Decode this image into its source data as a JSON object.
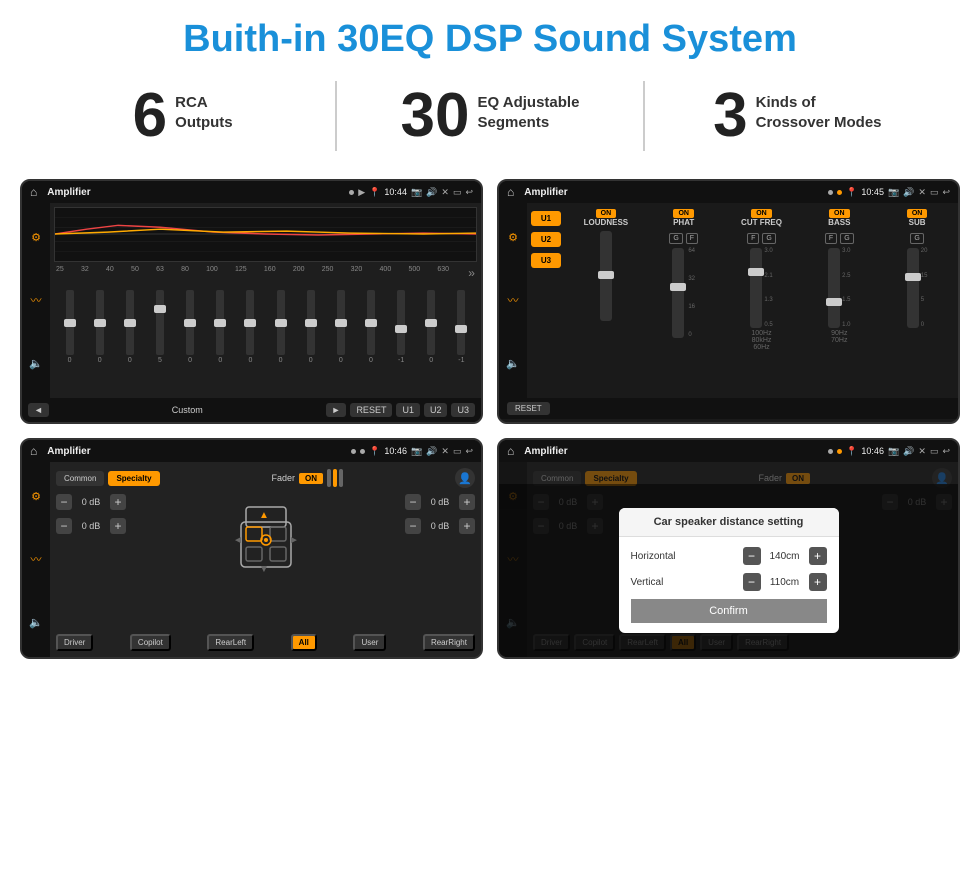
{
  "page": {
    "title": "Buith-in 30EQ DSP Sound System",
    "stats": [
      {
        "number": "6",
        "label": "RCA\nOutputs"
      },
      {
        "number": "30",
        "label": "EQ Adjustable\nSegments"
      },
      {
        "number": "3",
        "label": "Kinds of\nCrossover Modes"
      }
    ]
  },
  "screens": [
    {
      "id": "eq-screen",
      "statusBar": {
        "appName": "Amplifier",
        "time": "10:44",
        "dotOrange": false
      },
      "type": "eq",
      "presetName": "Custom",
      "controls": [
        "◄",
        "Custom",
        "►",
        "RESET",
        "U1",
        "U2",
        "U3"
      ],
      "frequencies": [
        "25",
        "32",
        "40",
        "50",
        "63",
        "80",
        "100",
        "125",
        "160",
        "200",
        "250",
        "320",
        "400",
        "500",
        "630"
      ],
      "values": [
        "0",
        "0",
        "0",
        "5",
        "0",
        "0",
        "0",
        "0",
        "0",
        "0",
        "0",
        "-1",
        "0",
        "-1"
      ]
    },
    {
      "id": "crossover-screen",
      "statusBar": {
        "appName": "Amplifier",
        "time": "10:45",
        "dotOrange": true
      },
      "type": "crossover",
      "presets": [
        "U1",
        "U2",
        "U3"
      ],
      "channels": [
        {
          "name": "LOUDNESS",
          "on": true
        },
        {
          "name": "PHAT",
          "on": true
        },
        {
          "name": "CUT FREQ",
          "on": true
        },
        {
          "name": "BASS",
          "on": true
        },
        {
          "name": "SUB",
          "on": true
        }
      ],
      "resetLabel": "RESET"
    },
    {
      "id": "fader-screen",
      "statusBar": {
        "appName": "Amplifier",
        "time": "10:46",
        "dotOrange": false
      },
      "type": "fader",
      "tabs": [
        "Common",
        "Specialty"
      ],
      "activeTab": "Specialty",
      "faderLabel": "Fader",
      "faderOn": "ON",
      "volumes": [
        "0 dB",
        "0 dB",
        "0 dB",
        "0 dB"
      ],
      "positions": [
        "Driver",
        "Copilot",
        "RearLeft",
        "All",
        "User",
        "RearRight"
      ]
    },
    {
      "id": "dialog-screen",
      "statusBar": {
        "appName": "Amplifier",
        "time": "10:46",
        "dotOrange": true
      },
      "type": "dialog",
      "dialog": {
        "title": "Car speaker distance setting",
        "horizontal": {
          "label": "Horizontal",
          "value": "140cm"
        },
        "vertical": {
          "label": "Vertical",
          "value": "110cm"
        },
        "confirmLabel": "Confirm"
      },
      "tabs": [
        "Common",
        "Specialty"
      ],
      "volumes": [
        "0 dB",
        "0 dB"
      ],
      "positions": [
        "Driver",
        "Copilot",
        "RearLeft",
        "All",
        "User",
        "RearRight"
      ]
    }
  ]
}
